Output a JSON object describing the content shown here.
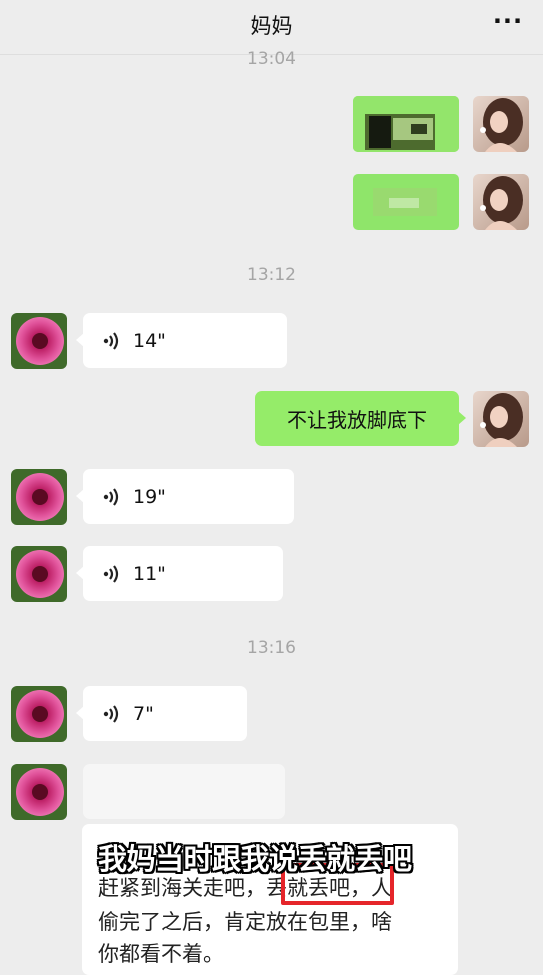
{
  "header": {
    "title": "妈妈",
    "more_icon": "more-icon",
    "more_label": "···"
  },
  "timestamps": {
    "t1": "13:04",
    "t2": "13:12",
    "t3": "13:16"
  },
  "messages": {
    "voice1": "14\"",
    "text1": "不让我放脚底下",
    "voice2": "19\"",
    "voice3": "11\"",
    "voice4": "7\""
  },
  "caption": {
    "overlay": "我妈当时跟我说丢就丢吧",
    "line1": "赶紧到海关走吧，丢就丢吧，人",
    "line2": "偷完了之后，肯定放在包里，啥",
    "line3": "你都看不着。"
  },
  "colors": {
    "background": "#ededed",
    "bubble_green": "#95ec69",
    "bubble_white": "#ffffff",
    "highlight_box": "#e5252a"
  }
}
